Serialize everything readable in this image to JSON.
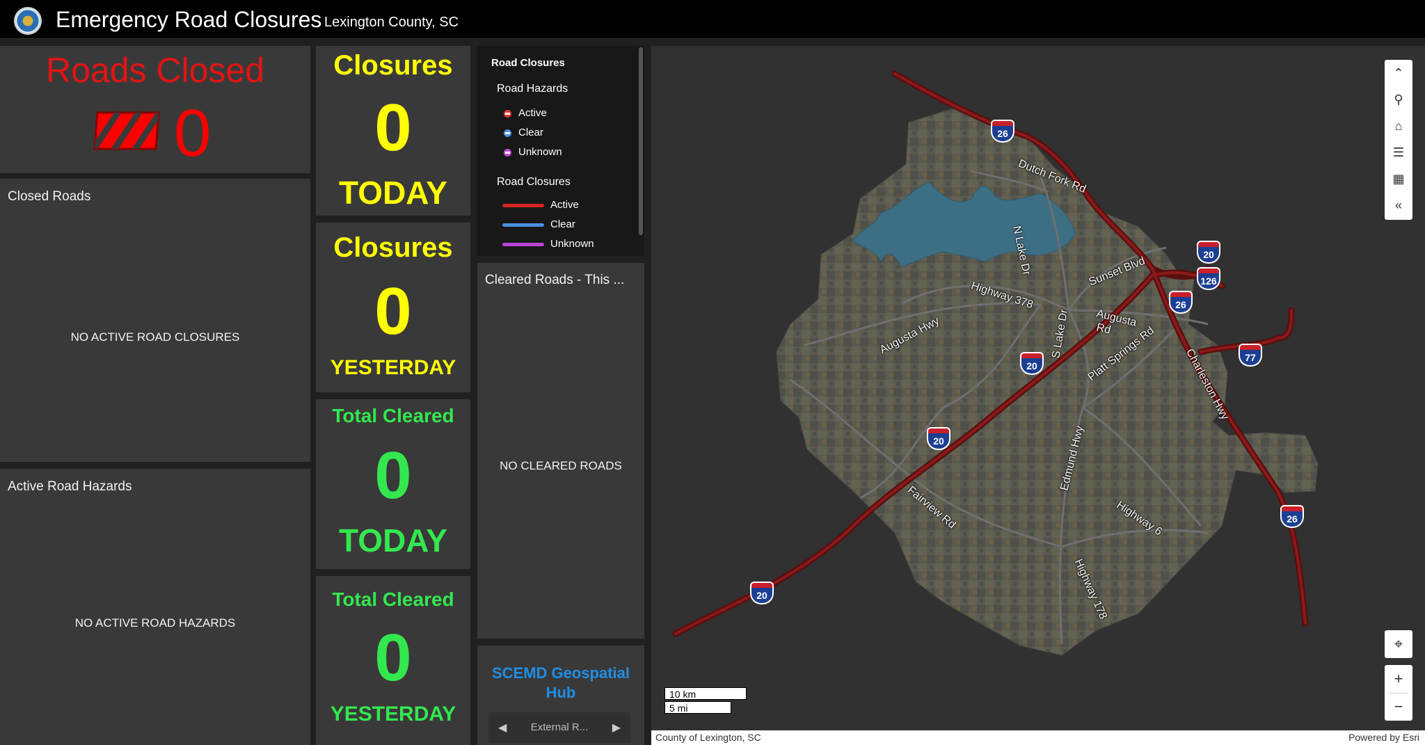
{
  "header": {
    "title": "Emergency Road Closures",
    "subtitle": "Lexington County, SC"
  },
  "roads_closed": {
    "title": "Roads Closed",
    "count": "0"
  },
  "closed_roads": {
    "title": "Closed Roads",
    "empty": "NO ACTIVE ROAD CLOSURES"
  },
  "active_hazards": {
    "title": "Active Road Hazards",
    "empty": "NO ACTIVE ROAD HAZARDS"
  },
  "stats": {
    "closures_today": {
      "label": "Closures",
      "value": "0",
      "period": "TODAY"
    },
    "closures_yesterday": {
      "label": "Closures",
      "value": "0",
      "period": "YESTERDAY"
    },
    "cleared_today": {
      "label": "Total Cleared",
      "value": "0",
      "period": "TODAY"
    },
    "cleared_yesterday": {
      "label": "Total Cleared",
      "value": "0",
      "period": "YESTERDAY"
    }
  },
  "legend": {
    "title": "Road Closures",
    "hazards_group": "Road Hazards",
    "hazards": [
      {
        "label": "Active",
        "color": "#e53935"
      },
      {
        "label": "Clear",
        "color": "#4a8fe0"
      },
      {
        "label": "Unknown",
        "color": "#c04ad8"
      }
    ],
    "closures_group": "Road Closures",
    "closures": [
      {
        "label": "Active",
        "color": "#d72424"
      },
      {
        "label": "Clear",
        "color": "#4a8fe0"
      },
      {
        "label": "Unknown",
        "color": "#b843d6"
      }
    ]
  },
  "cleared_roads": {
    "title": "Cleared Roads - This ...",
    "empty": "NO CLEARED ROADS"
  },
  "hub": {
    "link": "SCEMD Geospatial Hub",
    "external": "External R..."
  },
  "map": {
    "labels": {
      "dutch_fork": "Dutch Fork Rd",
      "n_lake": "N Lake Dr",
      "sunset": "Sunset Blvd",
      "hwy378": "Highway 378",
      "augusta_rd": "Augusta",
      "augusta_rd2": "Rd",
      "augusta_hwy": "Augusta Hwy",
      "s_lake": "S Lake Dr",
      "platt": "Platt Springs Rd",
      "charleston": "Charleston Hwy",
      "edmund": "Edmund Hwy",
      "fairview": "Fairview Rd",
      "hwy6": "Highway 6",
      "hwy178": "Highway 178"
    },
    "shields": {
      "i26_a": "26",
      "i20_a": "20",
      "i126": "126",
      "i26_b": "26",
      "i77": "77",
      "i20_b": "20",
      "i20_c": "20",
      "i26_c": "26",
      "i20_d": "20"
    },
    "scale_km": "10 km",
    "scale_mi": "5 mi",
    "attribution_left": "County of Lexington, SC",
    "attribution_right": "Powered by Esri"
  },
  "icons": {
    "collapse": "chevron-up-icon",
    "search": "search-icon",
    "home": "home-icon",
    "layers": "layers-icon",
    "qr": "qr-code-icon",
    "back": "chevrons-left-icon",
    "locate": "locate-icon",
    "zoom_in": "plus-icon",
    "zoom_out": "minus-icon"
  }
}
